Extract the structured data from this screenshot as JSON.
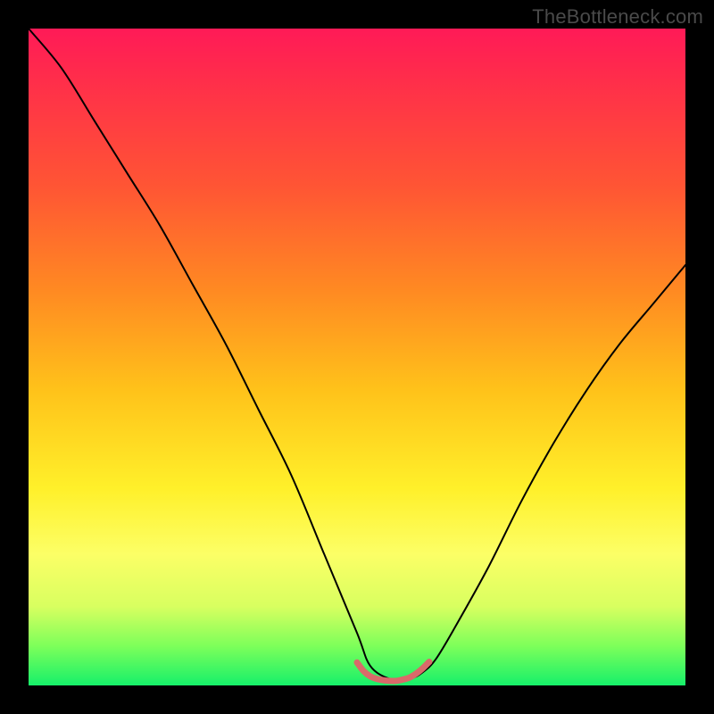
{
  "watermark": "TheBottleneck.com",
  "chart_data": {
    "type": "line",
    "title": "",
    "xlabel": "",
    "ylabel": "",
    "xlim": [
      0,
      100
    ],
    "ylim": [
      0,
      100
    ],
    "grid": false,
    "legend": "none",
    "gradient_colors": {
      "top": "#ff1a57",
      "upper_mid": "#ff8a22",
      "mid": "#fff02a",
      "lower_mid": "#d8ff60",
      "bottom": "#16f06a"
    },
    "series": [
      {
        "name": "bottleneck-curve-black",
        "color": "#000000",
        "x": [
          0,
          5,
          10,
          15,
          20,
          25,
          30,
          35,
          40,
          45,
          50,
          52,
          55,
          58,
          60,
          62,
          65,
          70,
          75,
          80,
          85,
          90,
          95,
          100
        ],
        "y": [
          100,
          94,
          86,
          78,
          70,
          61,
          52,
          42,
          32,
          20,
          8,
          3,
          1,
          1,
          2,
          4,
          9,
          18,
          28,
          37,
          45,
          52,
          58,
          64
        ]
      },
      {
        "name": "optimum-marker-red",
        "color": "#e06666",
        "x": [
          50,
          51,
          52,
          53,
          54,
          55,
          56,
          57,
          58,
          59,
          60,
          61
        ],
        "y": [
          3.5,
          2.2,
          1.4,
          1.0,
          0.8,
          0.7,
          0.7,
          0.9,
          1.2,
          1.8,
          2.6,
          3.6
        ]
      }
    ]
  }
}
